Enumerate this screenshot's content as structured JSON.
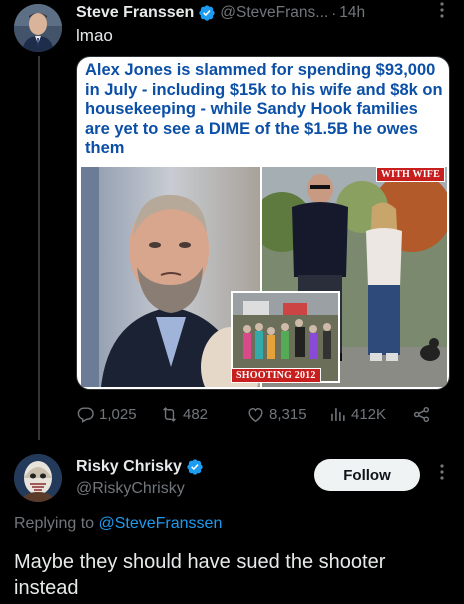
{
  "tweet": {
    "author": {
      "display_name": "Steve Franssen",
      "handle": "@SteveFrans...",
      "verified": true
    },
    "separator": "·",
    "time": "14h",
    "text": "lmao",
    "media": {
      "headline": "Alex Jones is slammed for spending $93,000 in July - including $15k to his wife and $8k on housekeeping - while Sandy Hook families are yet to see a DIME of the $1.5B he owes them",
      "tag_wife": "WITH WIFE",
      "tag_shooting": "SHOOTING 2012"
    },
    "actions": {
      "replies": "1,025",
      "retweets": "482",
      "likes": "8,315",
      "views": "412K"
    }
  },
  "reply": {
    "author": {
      "display_name": "Risky Chrisky",
      "handle": "@RiskyChrisky",
      "verified": true
    },
    "follow_label": "Follow",
    "replying_prefix": "Replying to",
    "replying_to": "@SteveFranssen",
    "text": "Maybe they should have sued the shooter instead"
  },
  "colors": {
    "background": "#000000",
    "text": "#e7e9ea",
    "muted": "#71767b",
    "accent": "#1d9bf0",
    "headline": "#0b4fa6",
    "tag_red": "#c81e1e"
  },
  "icons": {
    "verified": "verified-badge-icon",
    "more": "more-dots-icon",
    "reply": "reply-icon",
    "retweet": "retweet-icon",
    "like": "heart-icon",
    "views": "views-icon",
    "share": "share-icon"
  }
}
